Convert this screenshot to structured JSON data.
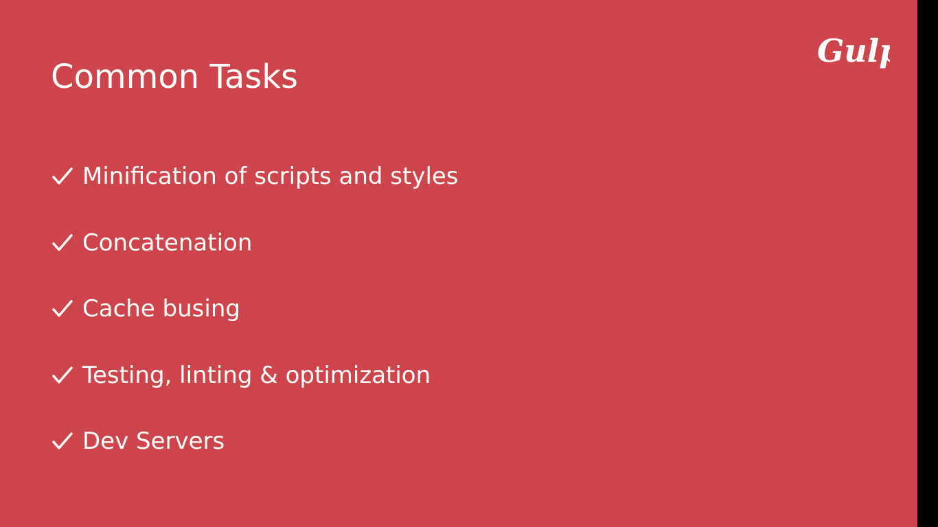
{
  "slide": {
    "title": "Common Tasks",
    "logo_text": "Gulp",
    "tasks": [
      {
        "label": "Minification of scripts and styles",
        "icon": "check-icon"
      },
      {
        "label": "Concatenation",
        "icon": "check-icon"
      },
      {
        "label": "Cache busing",
        "icon": "check-icon"
      },
      {
        "label": "Testing, linting & optimization",
        "icon": "check-icon"
      },
      {
        "label": "Dev Servers",
        "icon": "check-icon"
      }
    ]
  },
  "colors": {
    "background": "#CE444B",
    "text": "#FFFFFF",
    "side_bar": "#000000"
  }
}
